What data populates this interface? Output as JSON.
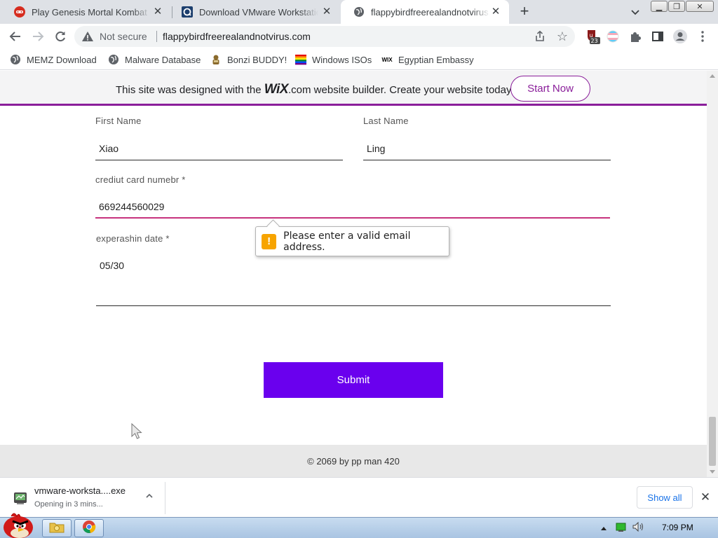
{
  "browser": {
    "tabs": [
      {
        "title": "Play Genesis Mortal Kombat (W",
        "favicon": "gamepad-icon",
        "active": false
      },
      {
        "title": "Download VMware Workstatio",
        "favicon": "vmware-icon",
        "active": false
      },
      {
        "title": "flappybirdfreerealandnotvirus.",
        "favicon": "globe-icon",
        "active": true
      }
    ],
    "security_label": "Not secure",
    "url": "flappybirdfreerealandnotvirus.com",
    "extension_badge": "23",
    "bookmarks": [
      {
        "label": "MEMZ Download",
        "icon": "globe-icon"
      },
      {
        "label": "Malware Database",
        "icon": "globe-icon"
      },
      {
        "label": "Bonzi BUDDY!",
        "icon": "bonzi-icon"
      },
      {
        "label": "Windows ISOs",
        "icon": "rainbow-icon"
      },
      {
        "label": "Egyptian Embassy",
        "icon": "wix-icon"
      }
    ]
  },
  "banner": {
    "text_before": "This site was designed with the",
    "logo": "WiX",
    "text_after": ".com website builder. Create your website today.",
    "button": "Start Now"
  },
  "form": {
    "first_name_label": "First Name",
    "first_name_value": "Xiao",
    "last_name_label": "Last Name",
    "last_name_value": "Ling",
    "card_label": "crediut card numebr *",
    "card_value": "669244560029",
    "expiry_label": "experashin date *",
    "expiry_value": "05/30",
    "validation_message": "Please enter a valid email address.",
    "submit_label": "Submit"
  },
  "footer": {
    "text": "© 2069 by pp man 420"
  },
  "download": {
    "filename": "vmware-worksta....exe",
    "status": "Opening in 3 mins...",
    "show_all": "Show all"
  },
  "taskbar": {
    "time": "7:09 PM"
  },
  "colors": {
    "banner_border": "#8a1e9a",
    "submit_bg": "#6a00ee",
    "error_underline": "#c7327d",
    "warning": "#f7a400"
  }
}
